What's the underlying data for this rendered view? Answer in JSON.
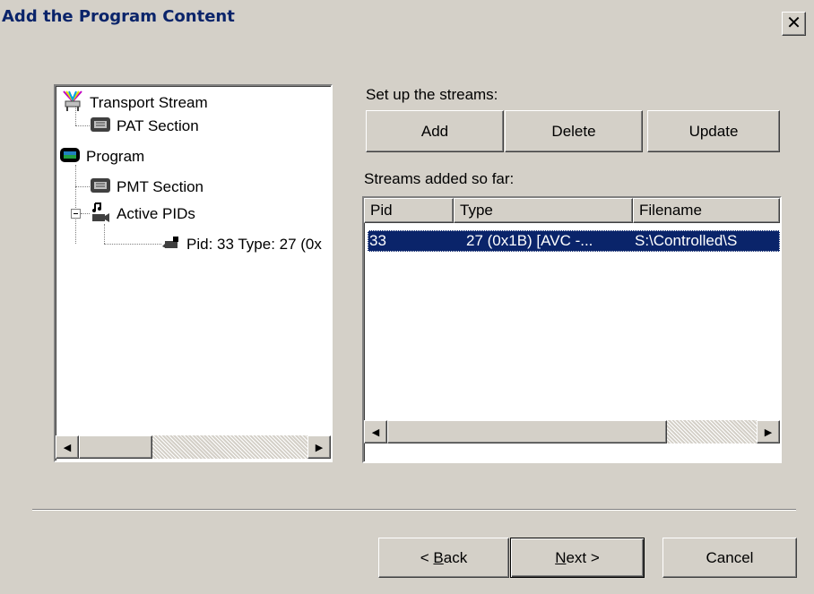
{
  "window": {
    "title": "Add the Program Content",
    "close_glyph": "✕"
  },
  "tree": {
    "items": [
      {
        "label": "Transport Stream",
        "icon": "transport-stream-icon"
      },
      {
        "label": "PAT Section",
        "icon": "section-icon"
      },
      {
        "label": "Program",
        "icon": "program-icon"
      },
      {
        "label": "PMT Section",
        "icon": "section-icon"
      },
      {
        "label": "Active PIDs",
        "icon": "active-pids-icon"
      },
      {
        "label": "Pid: 33 Type: 27 (0x",
        "icon": "pid-icon"
      }
    ]
  },
  "streams": {
    "setup_label": "Set up the streams:",
    "add_label": "Add",
    "delete_label": "Delete",
    "update_label": "Update",
    "added_label": "Streams added so far:",
    "columns": [
      "Pid",
      "Type",
      "Filename"
    ],
    "rows": [
      {
        "pid": "33",
        "type": "27 (0x1B) [AVC -...",
        "filename": "S:\\Controlled\\S"
      }
    ]
  },
  "footer": {
    "back_label_pre": "< ",
    "back_label_key": "B",
    "back_label_post": "ack",
    "next_label_key": "N",
    "next_label_post": "ext >",
    "cancel_label": "Cancel"
  },
  "colors": {
    "dialog_bg": "#d4d0c8",
    "title_text": "#0a246a",
    "selection": "#0a246a"
  }
}
